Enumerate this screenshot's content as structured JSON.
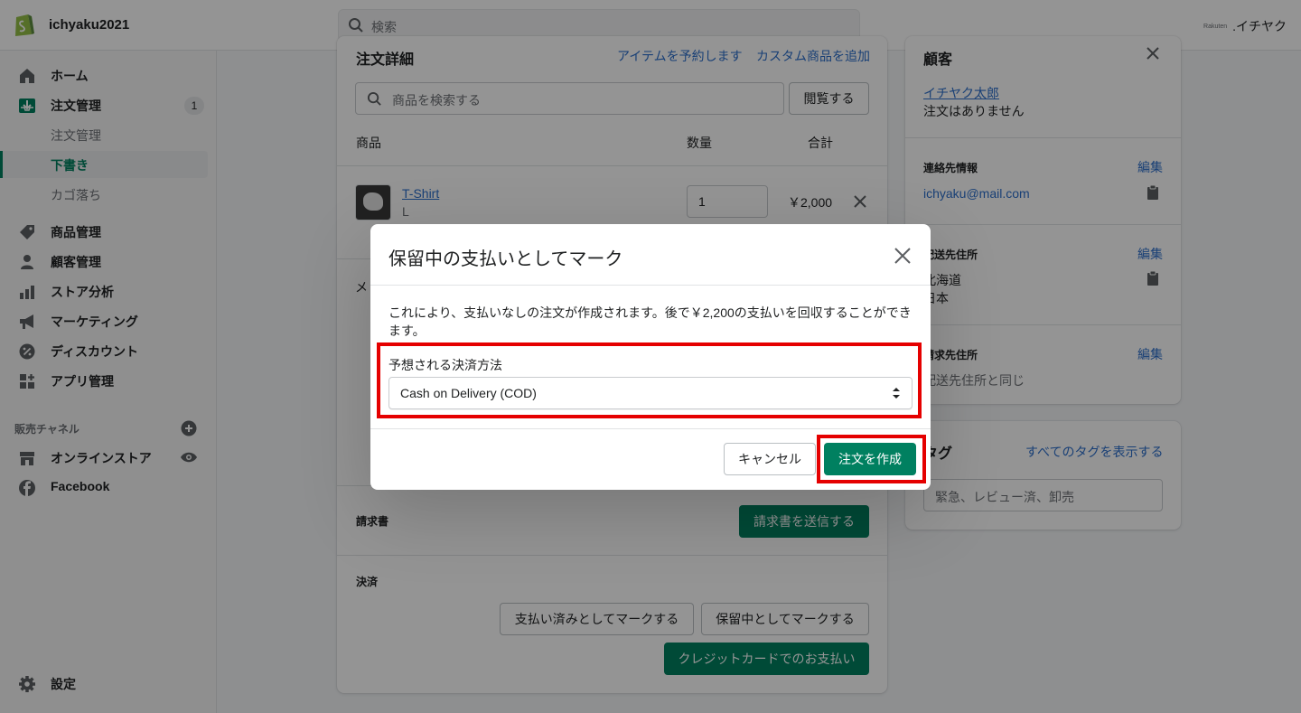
{
  "topbar": {
    "store_name": "ichyaku2021",
    "search_placeholder": "検索",
    "account_small": "Rakuten",
    "account_name": ".イチヤク"
  },
  "sidebar": {
    "items": [
      {
        "label": "ホーム"
      },
      {
        "label": "注文管理",
        "badge": "1"
      },
      {
        "label": "商品管理"
      },
      {
        "label": "顧客管理"
      },
      {
        "label": "ストア分析"
      },
      {
        "label": "マーケティング"
      },
      {
        "label": "ディスカウント"
      },
      {
        "label": "アプリ管理"
      }
    ],
    "sub_items": [
      {
        "label": "注文管理"
      },
      {
        "label": "下書き"
      },
      {
        "label": "カゴ落ち"
      }
    ],
    "channels_heading": "販売チャネル",
    "channels": [
      {
        "label": "オンラインストア"
      },
      {
        "label": "Facebook"
      }
    ],
    "settings_label": "設定"
  },
  "order": {
    "title": "注文詳細",
    "reserve_link": "アイテムを予約します",
    "custom_link": "カスタム商品を追加",
    "search_placeholder": "商品を検索する",
    "browse_button": "閲覧する",
    "col_product": "商品",
    "col_qty": "数量",
    "col_total": "合計",
    "product_name": "T-Shirt",
    "product_variant": "L",
    "product_qty": "1",
    "product_total": "￥2,000",
    "memo_partial": "メ",
    "invoice_heading": "請求書",
    "send_invoice_button": "請求書を送信する",
    "payment_heading": "決済",
    "mark_paid_button": "支払い済みとしてマークする",
    "mark_pending_button": "保留中としてマークする",
    "credit_card_button": "クレジットカードでのお支払い"
  },
  "customer": {
    "title": "顧客",
    "name": "イチヤク太郎",
    "orders_text": "注文はありません",
    "contact_heading": "連絡先情報",
    "edit_label": "編集",
    "email": "ichyaku@mail.com",
    "shipping_heading": "配送先住所",
    "shipping_line1": "北海道",
    "shipping_line2": "日本",
    "billing_heading": "請求先住所",
    "billing_text": "配送先住所と同じ"
  },
  "tags": {
    "title": "タグ",
    "show_all_link": "すべてのタグを表示する",
    "input_placeholder": "緊急、レビュー済、卸売"
  },
  "modal": {
    "title": "保留中の支払いとしてマーク",
    "body": "これにより、支払いなしの注文が作成されます。後で￥2,200の支払いを回収することができます。",
    "field_label": "予想される決済方法",
    "select_value": "Cash on Delivery (COD)",
    "cancel_button": "キャンセル",
    "create_button": "注文を作成"
  },
  "colors": {
    "primary": "#008060",
    "link": "#2c6ecb",
    "highlight": "#e50000"
  }
}
